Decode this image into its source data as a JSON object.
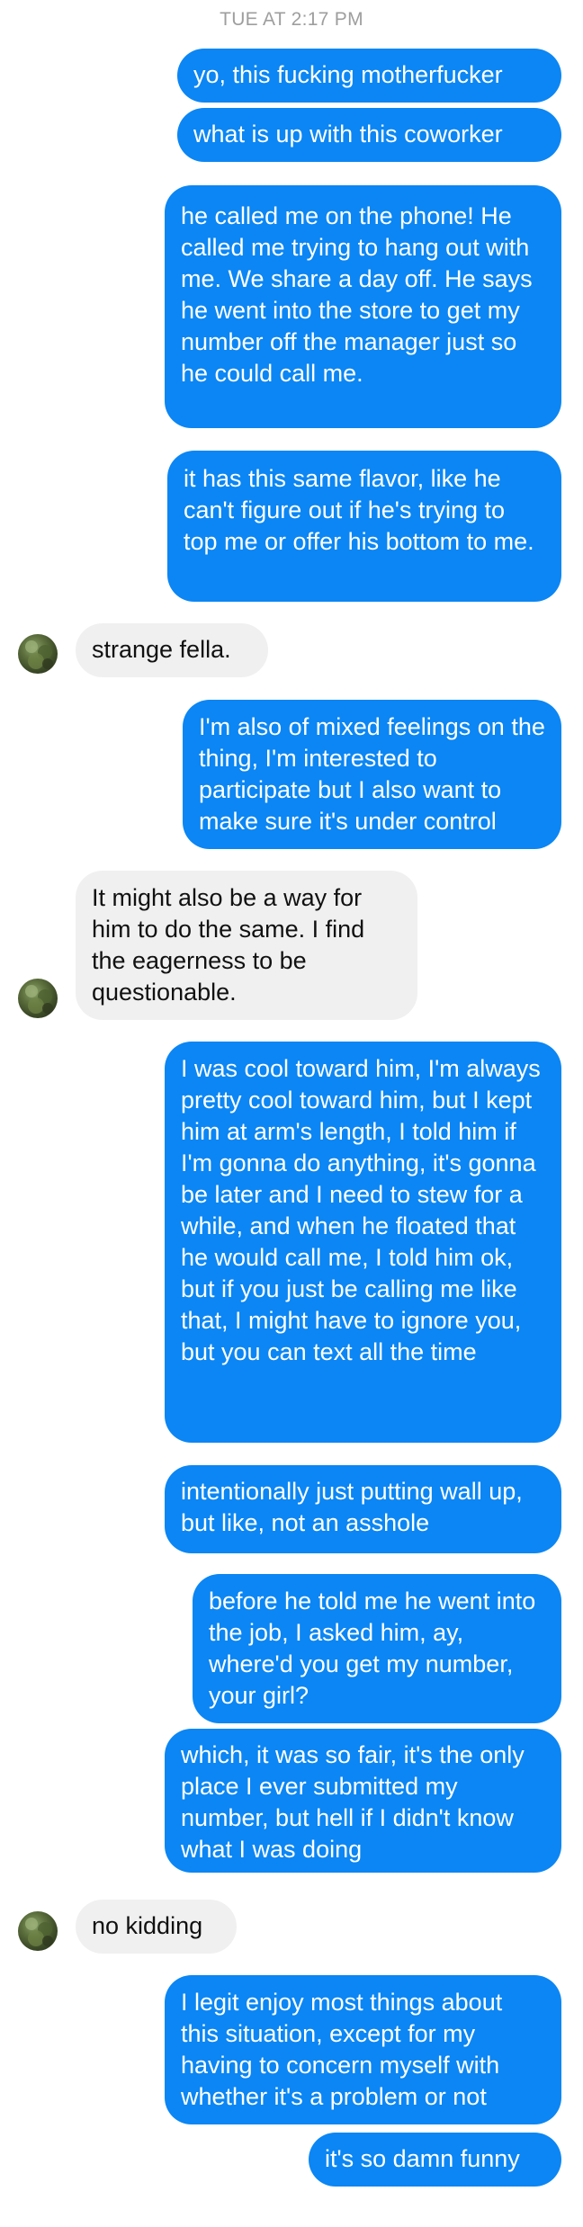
{
  "timestamp": "TUE AT 2:17 PM",
  "messages": [
    {
      "from": "me",
      "text": "yo, this fucking motherfucker"
    },
    {
      "from": "me",
      "text": "what is up with this coworker"
    },
    {
      "from": "me",
      "text": "he called me on the phone! He called me trying to hang out with me. We share a day off. He says he went into the store to get my number off the manager just so he could call me."
    },
    {
      "from": "me",
      "text": "it has this same flavor, like he can't figure out if he's trying to top me or offer his bottom to me."
    },
    {
      "from": "them",
      "text": "strange fella."
    },
    {
      "from": "me",
      "text": "I'm also of mixed feelings on the thing, I'm interested to participate but I also want to make sure it's under control"
    },
    {
      "from": "them",
      "text": "It might also be a way for him to do the same. I find the eagerness to be questionable."
    },
    {
      "from": "me",
      "text": "I was cool toward him, I'm always pretty cool toward him, but I kept him at arm's length, I told him if I'm gonna do anything, it's gonna be later and I need to stew for a while, and when he floated that he would call me, I told him ok, but if you just be calling me like that, I might have to ignore you, but you can text all the time"
    },
    {
      "from": "me",
      "text": "intentionally just putting wall up, but like, not an asshole"
    },
    {
      "from": "me",
      "text": "before he told me he went into the job, I asked him, ay, where'd you get my number, your girl?"
    },
    {
      "from": "me",
      "text": "which, it was so fair, it's the only place I ever submitted my number, but hell if I didn't know what I was doing"
    },
    {
      "from": "them",
      "text": "no kidding"
    },
    {
      "from": "me",
      "text": "I legit enjoy most things about this situation, except for my having to concern myself with whether it's a problem or not"
    },
    {
      "from": "me",
      "text": "it's so damn funny"
    }
  ],
  "colors": {
    "outgoing_bubble": "#0b86f4",
    "incoming_bubble": "#f0f0f0",
    "timestamp_text": "#9e9e9e"
  },
  "icons": {
    "avatar": "contact-avatar-photo"
  }
}
